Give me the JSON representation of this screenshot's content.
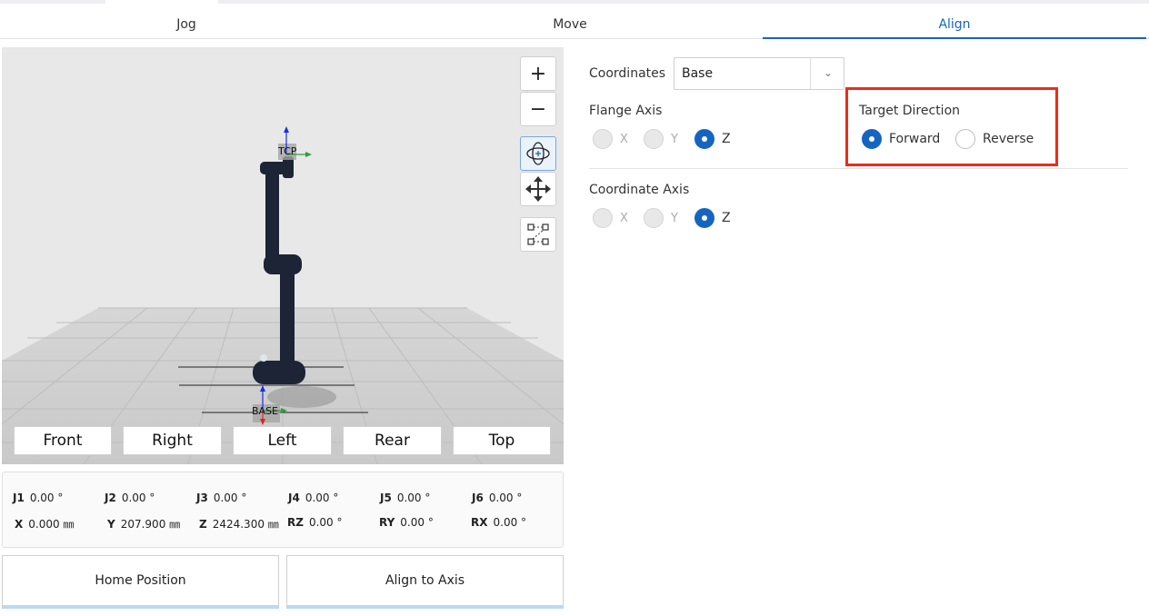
{
  "tabs": [
    {
      "label": "Jog",
      "active": false
    },
    {
      "label": "Move",
      "active": false
    },
    {
      "label": "Align",
      "active": true
    }
  ],
  "viewport": {
    "zoom_in": "+",
    "zoom_out": "−",
    "labels": {
      "tcp": "TCP",
      "base": "BASE"
    },
    "views": [
      "Front",
      "Right",
      "Left",
      "Rear",
      "Top"
    ]
  },
  "joints": {
    "row1": [
      {
        "name": "J1",
        "value": "0.00 °"
      },
      {
        "name": "J2",
        "value": "0.00 °"
      },
      {
        "name": "J3",
        "value": "0.00 °"
      },
      {
        "name": "J4",
        "value": "0.00 °"
      },
      {
        "name": "J5",
        "value": "0.00 °"
      },
      {
        "name": "J6",
        "value": "0.00 °"
      }
    ],
    "row2": [
      {
        "name": "X",
        "value": "0.000 ㎜"
      },
      {
        "name": "Y",
        "value": "207.900 ㎜"
      },
      {
        "name": "Z",
        "value": "2424.300 ㎜"
      },
      {
        "name": "RZ",
        "value": "0.00 °"
      },
      {
        "name": "RY",
        "value": "0.00 °"
      },
      {
        "name": "RX",
        "value": "0.00 °"
      }
    ]
  },
  "buttons": {
    "home": "Home Position",
    "align": "Align to Axis"
  },
  "align": {
    "coordinates_label": "Coordinates",
    "coordinates_value": "Base",
    "flange_axis_label": "Flange Axis",
    "flange_axis": [
      {
        "label": "X",
        "selected": false
      },
      {
        "label": "Y",
        "selected": false
      },
      {
        "label": "Z",
        "selected": true
      }
    ],
    "target_direction_label": "Target Direction",
    "target_direction": [
      {
        "label": "Forward",
        "selected": true
      },
      {
        "label": "Reverse",
        "selected": false
      }
    ],
    "coordinate_axis_label": "Coordinate Axis",
    "coordinate_axis": [
      {
        "label": "X",
        "selected": false
      },
      {
        "label": "Y",
        "selected": false
      },
      {
        "label": "Z",
        "selected": true
      }
    ]
  },
  "colors": {
    "accent": "#1565c0",
    "highlight": "#ef2b1a",
    "robot": "#1c2436"
  },
  "icons": {
    "select": "chevron-down-icon",
    "orbit": "orbit-icon",
    "pan": "pan-arrows-icon",
    "fit": "fit-view-icon"
  }
}
